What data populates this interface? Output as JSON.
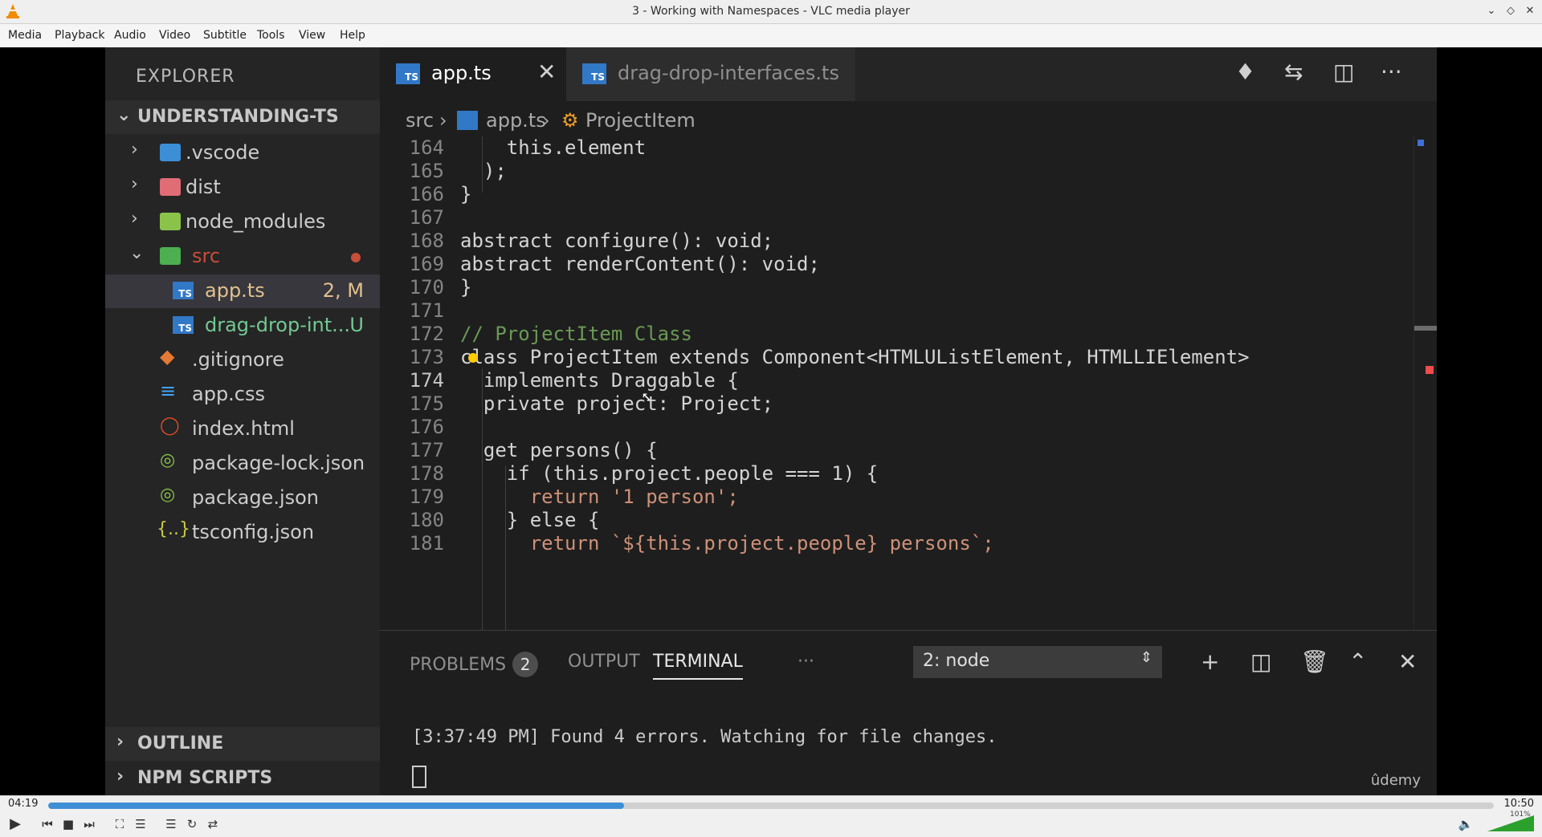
{
  "window": {
    "title": "3 - Working with Namespaces - VLC media player"
  },
  "menubar": [
    "Media",
    "Playback",
    "Audio",
    "Video",
    "Subtitle",
    "Tools",
    "View",
    "Help"
  ],
  "explorer": {
    "title": "EXPLORER",
    "root": "UNDERSTANDING-TS",
    "items": [
      {
        "name": ".vscode"
      },
      {
        "name": "dist"
      },
      {
        "name": "node_modules"
      },
      {
        "name": "src"
      },
      {
        "name": "app.ts",
        "badge": "2, M"
      },
      {
        "name": "drag-drop-int...",
        "badge": "U"
      },
      {
        "name": ".gitignore"
      },
      {
        "name": "app.css"
      },
      {
        "name": "index.html"
      },
      {
        "name": "package-lock.json"
      },
      {
        "name": "package.json"
      },
      {
        "name": "tsconfig.json"
      }
    ],
    "outline": "OUTLINE",
    "npm_scripts": "NPM SCRIPTS"
  },
  "tabs": [
    {
      "label": "app.ts"
    },
    {
      "label": "drag-drop-interfaces.ts"
    }
  ],
  "breadcrumb": {
    "folder": "src",
    "file": "app.ts",
    "symbol": "ProjectItem"
  },
  "code": {
    "line_numbers": [
      "164",
      "165",
      "166",
      "167",
      "168",
      "169",
      "170",
      "171",
      "172",
      "173",
      "174",
      "175",
      "176",
      "177",
      "178",
      "179",
      "180",
      "181"
    ],
    "lines": [
      "    this.element",
      "  );",
      "}",
      "",
      "abstract configure(): void;",
      "abstract renderContent(): void;",
      "}",
      "",
      "// ProjectItem Class",
      "class ProjectItem extends Component<HTMLUListElement, HTMLLIElement>",
      "  implements Draggable {",
      "  private project: Project;",
      "",
      "  get persons() {",
      "    if (this.project.people === 1) {",
      "      return '1 person';",
      "    } else {",
      "      return `${this.project.people} persons`;"
    ]
  },
  "panel": {
    "problems": "PROBLEMS",
    "problems_count": "2",
    "output": "OUTPUT",
    "terminal": "TERMINAL",
    "more": "···",
    "terminal_select": "2: node",
    "terminal_text": "[3:37:49 PM] Found 4 errors. Watching for file changes.",
    "watermark": "ûdemy"
  },
  "player": {
    "time_current": "04:19",
    "time_total": "10:50",
    "progress_fraction": 0.3985,
    "volume_percent": "101%"
  }
}
